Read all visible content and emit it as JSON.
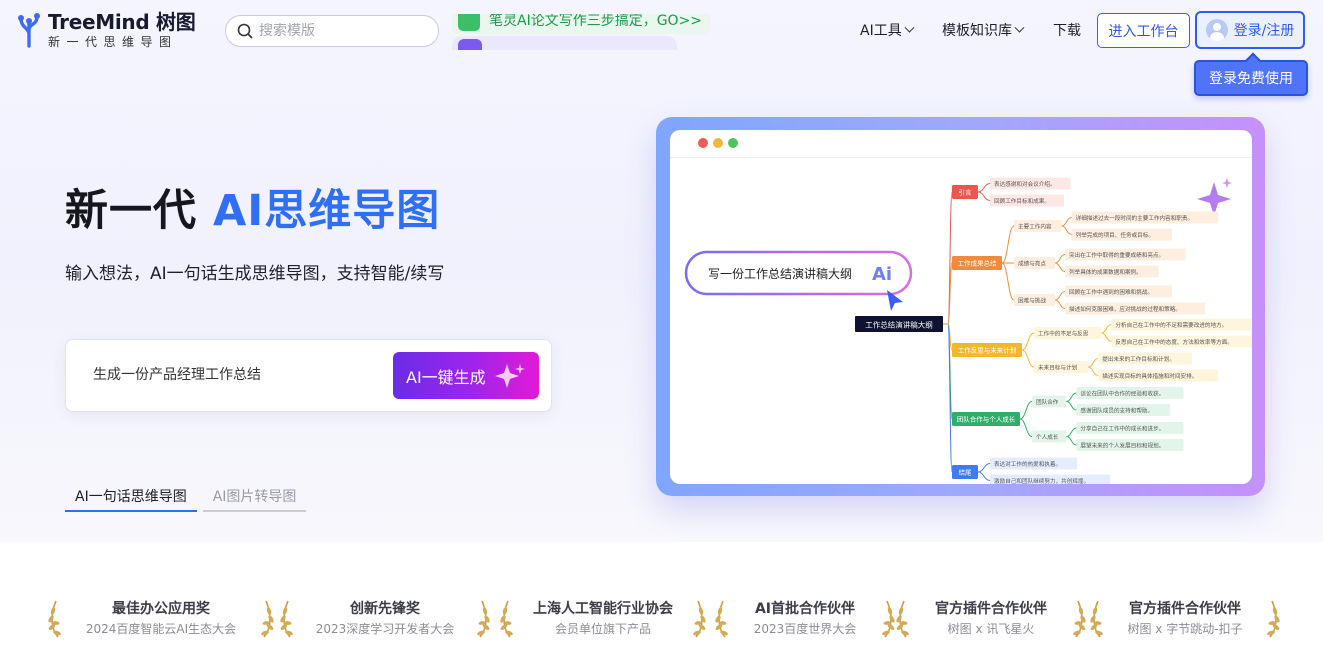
{
  "header": {
    "logo_name": "TreeMind 树图",
    "logo_sub": "新一代思维导图",
    "search_placeholder": "搜索模版",
    "promo_1": "笔灵AI论文写作三步搞定，GO>>",
    "nav": [
      {
        "label": "AI工具",
        "has_dropdown": true
      },
      {
        "label": "模板知识库",
        "has_dropdown": true
      },
      {
        "label": "下载",
        "has_dropdown": false
      }
    ],
    "workspace_button": "进入工作台",
    "login_button": "登录/注册",
    "tooltip": "登录免费使用"
  },
  "hero": {
    "title_prefix": "新一代 ",
    "title_accent": "AI思维导图",
    "subtitle": "输入想法，AI一句话生成思维导图，支持智能/续写",
    "input_value": "生成一份产品经理工作总结",
    "generate_button": "AI一键生成",
    "tabs": [
      {
        "label": "AI一句话思维导图",
        "active": true
      },
      {
        "label": "AI图片转导图",
        "active": false
      }
    ]
  },
  "preview": {
    "prompt": "写一份工作总结演讲稿大纲",
    "root": "工作总结演讲稿大纲",
    "branches": [
      {
        "label": "引言",
        "color": "#e8584f",
        "items": [
          "表达感谢和对会议介绍。",
          "回顾工作目标和成果。"
        ]
      },
      {
        "label": "工作成果总结",
        "color": "#f08b3c",
        "subs": [
          {
            "label": "主要工作内容",
            "items": [
              "详细描述过去一段时间的主要工作内容和职责。",
              "列举完成的项目、任务或目标。"
            ]
          },
          {
            "label": "成绩与亮点",
            "items": [
              "突出在工作中取得的重要成绩和亮点。",
              "列举具体的成果数据和案例。"
            ]
          },
          {
            "label": "困难与挑战",
            "items": [
              "回顾在工作中遇到的困难和挑战。",
              "描述如何克服困难，应对挑战的过程和策略。"
            ]
          }
        ]
      },
      {
        "label": "工作反思与未来计划",
        "color": "#f2b82c",
        "subs": [
          {
            "label": "工作中的不足与反思",
            "items": [
              "分析自己在工作中的不足和需要改进的地方。",
              "反思自己在工作中的态度、方法和效率等方面。"
            ]
          },
          {
            "label": "未来目标与计划",
            "items": [
              "提出未来的工作目标和计划。",
              "描述实现目标的具体措施和时间安排。"
            ]
          }
        ]
      },
      {
        "label": "团队合作与个人成长",
        "color": "#2fae6b",
        "subs": [
          {
            "label": "团队合作",
            "items": [
              "谈论在团队中合作的经验和收获。",
              "感谢团队成员的支持和帮助。"
            ]
          },
          {
            "label": "个人成长",
            "items": [
              "分享自己在工作中的成长和进步。",
              "展望未来的个人发展目标和规划。"
            ]
          }
        ]
      },
      {
        "label": "结尾",
        "color": "#3f7bf0",
        "items": [
          "表达对工作的热爱和执着。",
          "激励自己和团队继续努力，共创辉煌。"
        ]
      }
    ]
  },
  "awards": [
    {
      "title": "最佳办公应用奖",
      "sub": "2024百度智能云AI生态大会"
    },
    {
      "title": "创新先锋奖",
      "sub": "2023深度学习开发者大会"
    },
    {
      "title": "上海人工智能行业协会",
      "sub": "会员单位旗下产品"
    },
    {
      "title": "AI首批合作伙伴",
      "sub": "2023百度世界大会"
    },
    {
      "title": "官方插件合作伙伴",
      "sub": "树图 x 讯飞星火"
    },
    {
      "title": "官方插件合作伙伴",
      "sub": "树图 x 字节跳动-扣子"
    }
  ]
}
